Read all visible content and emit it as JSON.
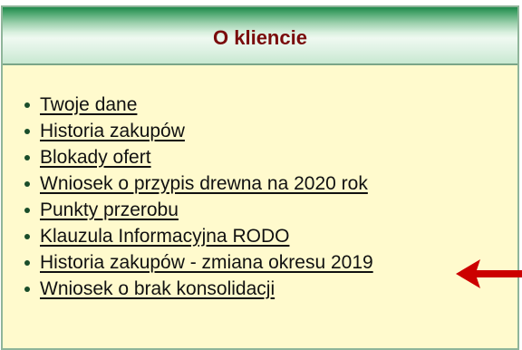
{
  "panel": {
    "title": "O kliencie"
  },
  "menu": {
    "items": [
      {
        "label": "Twoje dane"
      },
      {
        "label": "Historia zakupów"
      },
      {
        "label": "Blokady ofert"
      },
      {
        "label": "Wniosek o przypis drewna na 2020 rok"
      },
      {
        "label": "Punkty przerobu"
      },
      {
        "label": "Klauzula Informacyjna RODO"
      },
      {
        "label": "Historia zakupów - zmiana okresu 2019"
      },
      {
        "label": "Wniosek o brak konsolidacji"
      }
    ]
  },
  "annotation": {
    "arrow_icon": "arrow-left-icon",
    "arrow_color": "#cc0000"
  },
  "colors": {
    "header_green": "#1f8a4c",
    "title_color": "#7a0d0d",
    "panel_background": "#fffacd",
    "bullet_color": "#1a4d2a"
  }
}
